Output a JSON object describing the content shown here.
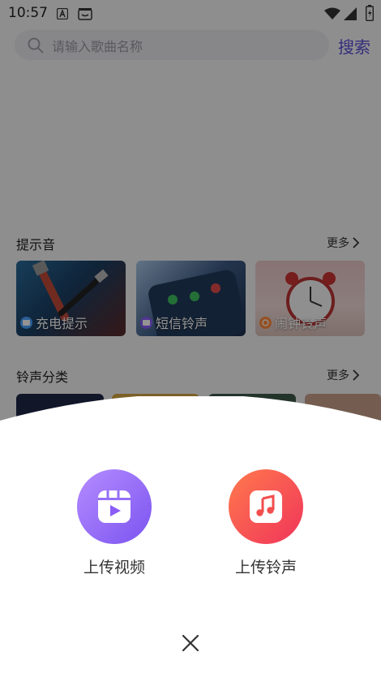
{
  "status_bar": {
    "time": "10:57",
    "icons": [
      "a-letter-icon",
      "robot-icon",
      "wifi-icon",
      "signal-icon",
      "battery-icon"
    ]
  },
  "search": {
    "placeholder": "请输入歌曲名称",
    "button_label": "搜索"
  },
  "sections": {
    "tips": {
      "title": "提示音",
      "more": "更多",
      "cards": [
        {
          "label": "充电提示",
          "badge_color": "#4aa3ff"
        },
        {
          "label": "短信铃声",
          "badge_color": "#8b5cf6"
        },
        {
          "label": "闹钟铃声",
          "badge_color": "#ff8a3d"
        }
      ]
    },
    "categories": {
      "title": "铃声分类",
      "more": "更多"
    }
  },
  "sheet": {
    "actions": [
      {
        "label": "上传视频",
        "color_from": "#b58cff",
        "color_to": "#7b54f0",
        "icon": "video-play-icon"
      },
      {
        "label": "上传铃声",
        "color_from": "#ff7a4d",
        "color_to": "#f0345a",
        "icon": "music-note-icon"
      }
    ],
    "close_icon": "close-icon"
  },
  "colors": {
    "accent": "#5b4fd6",
    "overlay": "rgba(0,0,0,0.42)"
  }
}
